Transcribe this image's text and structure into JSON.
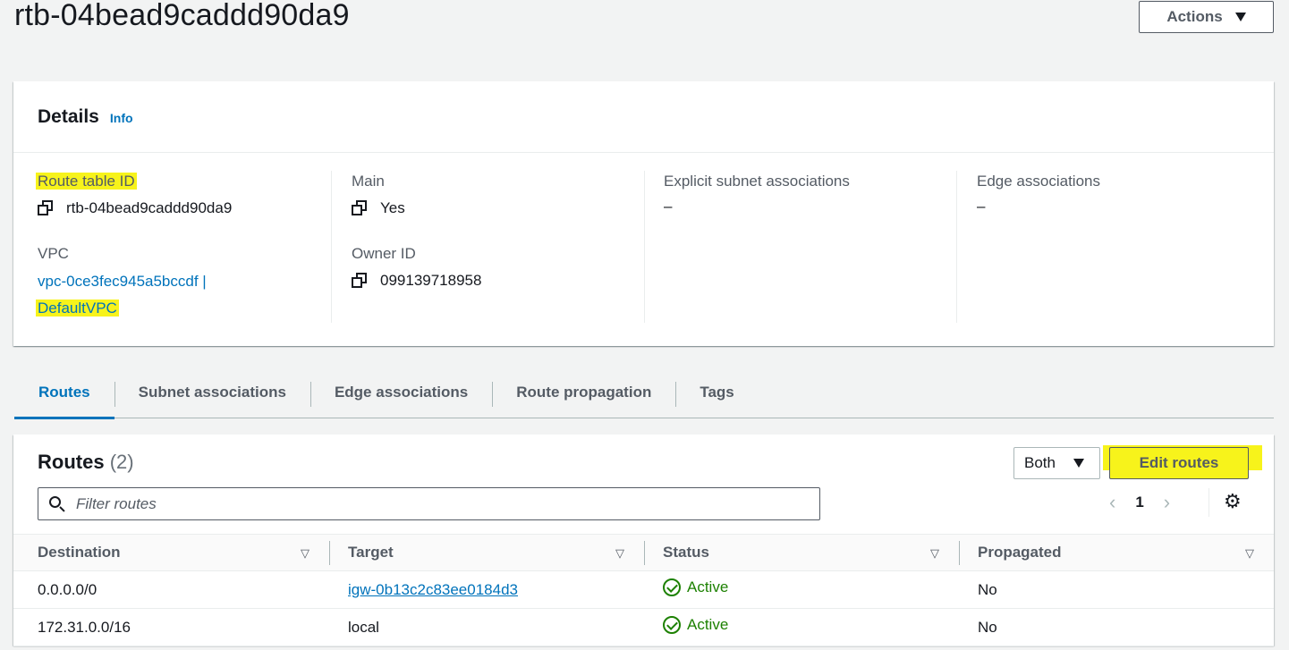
{
  "page": {
    "title": "rtb-04bead9caddd90da9"
  },
  "actions": {
    "label": "Actions"
  },
  "details": {
    "title": "Details",
    "info": "Info",
    "route_table_id": {
      "label": "Route table ID",
      "value": "rtb-04bead9caddd90da9"
    },
    "vpc": {
      "label": "VPC",
      "link_line1": "vpc-0ce3fec945a5bccdf |",
      "link_line2": "DefaultVPC"
    },
    "main": {
      "label": "Main",
      "value": "Yes"
    },
    "owner_id": {
      "label": "Owner ID",
      "value": "099139718958"
    },
    "explicit_subnet": {
      "label": "Explicit subnet associations",
      "value": "–"
    },
    "edge_assoc": {
      "label": "Edge associations",
      "value": "–"
    }
  },
  "tabs": [
    {
      "label": "Routes",
      "active": true
    },
    {
      "label": "Subnet associations"
    },
    {
      "label": "Edge associations"
    },
    {
      "label": "Route propagation"
    },
    {
      "label": "Tags"
    }
  ],
  "routes": {
    "title": "Routes",
    "count": "(2)",
    "filter_select": "Both",
    "edit_button": "Edit routes",
    "search_placeholder": "Filter routes",
    "page": "1",
    "columns": [
      "Destination",
      "Target",
      "Status",
      "Propagated"
    ],
    "rows": [
      {
        "destination": "0.0.0.0/0",
        "target": "igw-0b13c2c83ee0184d3",
        "status": "Active",
        "propagated": "No"
      },
      {
        "destination": "172.31.0.0/16",
        "target": "local",
        "status": "Active",
        "propagated": "No"
      }
    ]
  },
  "colors": {
    "accent": "#0073bb",
    "success": "#1d8102",
    "highlight": "#f7f31b"
  }
}
